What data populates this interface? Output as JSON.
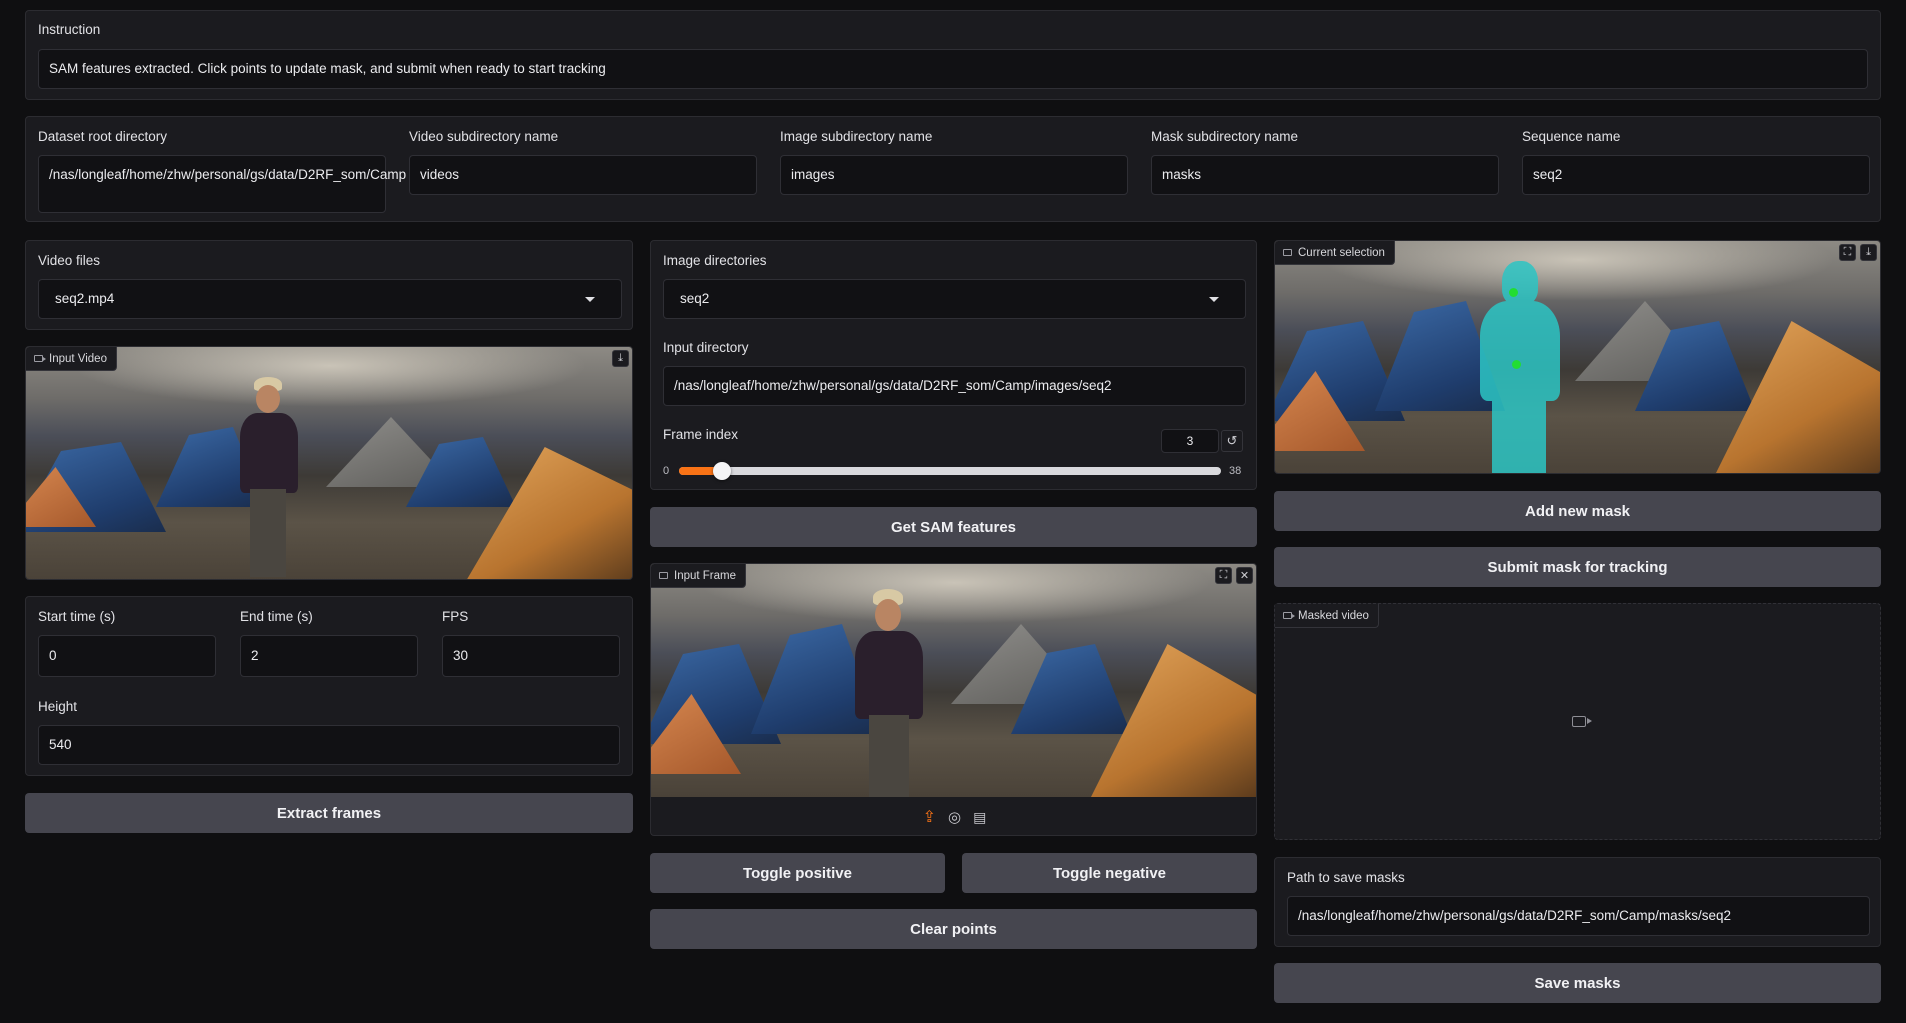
{
  "instruction": {
    "label": "Instruction",
    "text": "SAM features extracted. Click points to update mask, and submit when ready to start tracking"
  },
  "dirs": {
    "dataset_root_label": "Dataset root directory",
    "dataset_root_value": "/nas/longleaf/home/zhw/personal/gs/data/D2RF_som/Camp",
    "video_sub_label": "Video subdirectory name",
    "video_sub_value": "videos",
    "image_sub_label": "Image subdirectory name",
    "image_sub_value": "images",
    "mask_sub_label": "Mask subdirectory name",
    "mask_sub_value": "masks",
    "sequence_label": "Sequence name",
    "sequence_value": "seq2"
  },
  "left": {
    "video_files_label": "Video files",
    "video_files_value": "seq2.mp4",
    "input_video_tag": "Input Video",
    "start_label": "Start time (s)",
    "start_value": "0",
    "end_label": "End time (s)",
    "end_value": "2",
    "fps_label": "FPS",
    "fps_value": "30",
    "height_label": "Height",
    "height_value": "540",
    "extract_button": "Extract frames"
  },
  "middle": {
    "image_dirs_label": "Image directories",
    "image_dirs_value": "seq2",
    "input_dir_label": "Input directory",
    "input_dir_value": "/nas/longleaf/home/zhw/personal/gs/data/D2RF_som/Camp/images/seq2",
    "frame_index_label": "Frame index",
    "frame_index_value": "3",
    "slider_min": "0",
    "slider_max": "38",
    "slider_fraction": 0.079,
    "sam_button": "Get SAM features",
    "input_frame_tag": "Input Frame",
    "toggle_positive": "Toggle positive",
    "toggle_negative": "Toggle negative",
    "clear_points": "Clear points"
  },
  "right": {
    "current_selection_tag": "Current selection",
    "add_mask_button": "Add new mask",
    "submit_button": "Submit mask for tracking",
    "masked_video_tag": "Masked video",
    "save_path_label": "Path to save masks",
    "save_path_value": "/nas/longleaf/home/zhw/personal/gs/data/D2RF_som/Camp/masks/seq2",
    "save_button": "Save masks"
  },
  "colors": {
    "accent": "#f97316",
    "mask": "#2cc5c4",
    "point": "#22dd33"
  }
}
